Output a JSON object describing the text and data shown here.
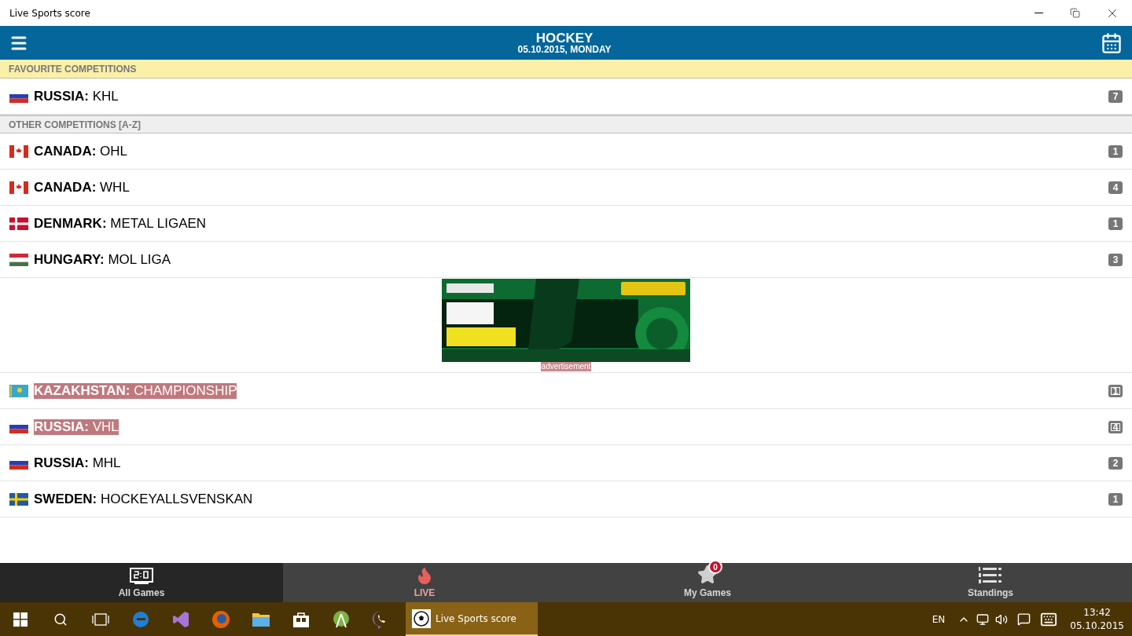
{
  "window": {
    "title": "Live Sports score"
  },
  "header": {
    "sport": "HOCKEY",
    "date": "05.10.2015, MONDAY"
  },
  "sections": [
    {
      "title": "FAVOURITE COMPETITIONS",
      "kind": "favourite",
      "rows": [
        {
          "kind": "competition",
          "flag": {
            "kind": "ru"
          },
          "country": "RUSSIA:",
          "league": "KHL",
          "count": "7",
          "highlighted": false
        }
      ]
    },
    {
      "title": "OTHER COMPETITIONS [A-Z]",
      "kind": "other",
      "rows": [
        {
          "kind": "competition",
          "flag": {
            "kind": "ca"
          },
          "country": "CANADA:",
          "league": "OHL",
          "count": "1",
          "highlighted": false
        },
        {
          "kind": "competition",
          "flag": {
            "kind": "ca"
          },
          "country": "CANADA:",
          "league": "WHL",
          "count": "4",
          "highlighted": false
        },
        {
          "kind": "competition",
          "flag": {
            "kind": "dk"
          },
          "country": "DENMARK:",
          "league": "METAL LIGAEN",
          "count": "1",
          "highlighted": false
        },
        {
          "kind": "competition",
          "flag": {
            "kind": "hu"
          },
          "country": "HUNGARY:",
          "league": "MOL LIGA",
          "count": "3",
          "highlighted": false
        },
        {
          "kind": "ad",
          "label": "advertisement"
        },
        {
          "kind": "competition",
          "flag": {
            "kind": "kz"
          },
          "country": "KAZAKHSTAN:",
          "league": "CHAMPIONSHIP",
          "count": "1",
          "highlighted": true
        },
        {
          "kind": "competition",
          "flag": {
            "kind": "ru"
          },
          "country": "RUSSIA:",
          "league": "VHL",
          "count": "4",
          "highlighted": true
        },
        {
          "kind": "competition",
          "flag": {
            "kind": "ru"
          },
          "country": "RUSSIA:",
          "league": "MHL",
          "count": "2",
          "highlighted": false
        },
        {
          "kind": "competition",
          "flag": {
            "kind": "se"
          },
          "country": "SWEDEN:",
          "league": "HOCKEYALLSVENSKAN",
          "count": "1",
          "highlighted": false
        }
      ]
    }
  ],
  "tabs": [
    {
      "kind": "score",
      "label": "All Games",
      "selected": true
    },
    {
      "kind": "live",
      "label": "LIVE",
      "selected": false
    },
    {
      "kind": "star",
      "label": "My Games",
      "badge": "0",
      "selected": false
    },
    {
      "kind": "standings",
      "label": "Standings",
      "selected": false
    }
  ],
  "taskbar": {
    "app": "Live Sports score",
    "language": "EN",
    "time": "13:42",
    "date": "05.10.2015"
  }
}
